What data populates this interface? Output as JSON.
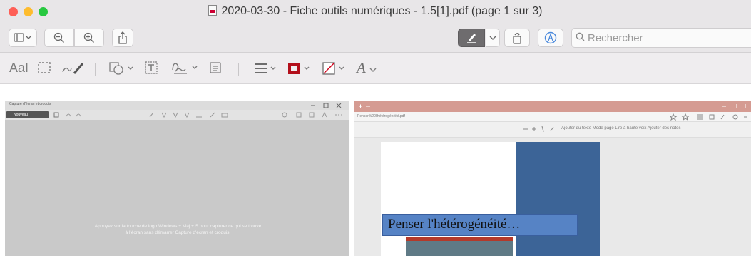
{
  "window": {
    "title": "2020-03-30 - Fiche outils numériques - 1.5[1].pdf (page 1 sur 3)",
    "traffic_lights": {
      "close": "#fe5f57",
      "minimize": "#febc2e",
      "zoom": "#28c840"
    }
  },
  "toolbar": {
    "search_placeholder": "Rechercher",
    "accent_color": "#4a89dc"
  },
  "markup_bar": {
    "text_tool_label": "AaI",
    "font_tool_label": "A"
  },
  "left_panel": {
    "window_title": "Capture d'écran et croquis",
    "new_button_label": "Nouveau",
    "message": "Appuyez sur la touche de logo Windows + Maj + S pour capturer ce qui se trouve à l'écran sans démarrer Capture d'écran et croquis."
  },
  "right_panel": {
    "address": "Penser%20l'hétérogénéité.pdf",
    "tools_text": "Ajouter du texte   Mode page   Lire à haute voix   Ajouter des notes",
    "banner_text": "Penser l'hétérogénéité…"
  }
}
